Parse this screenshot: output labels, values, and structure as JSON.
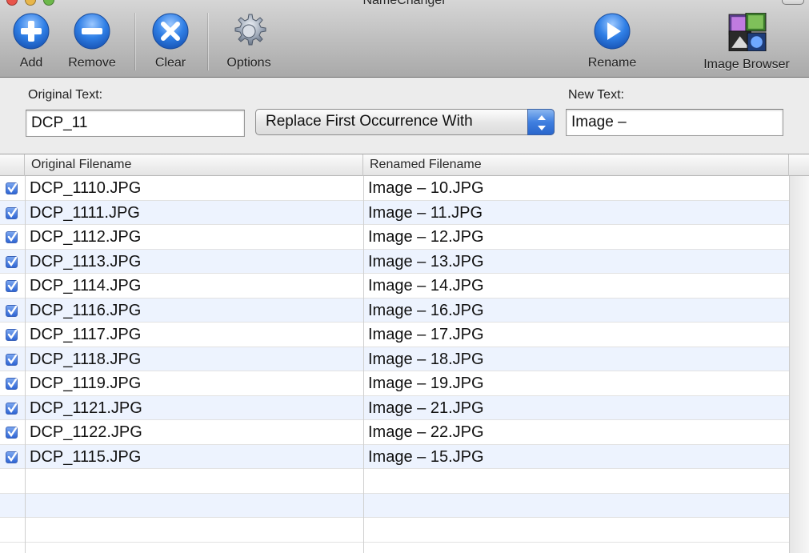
{
  "window": {
    "title": "NameChanger"
  },
  "toolbar": {
    "items": [
      {
        "label": "Add",
        "icon": "plus-circle-icon"
      },
      {
        "label": "Remove",
        "icon": "minus-circle-icon"
      },
      {
        "label": "Clear",
        "icon": "x-circle-icon"
      },
      {
        "label": "Options",
        "icon": "gear-icon"
      },
      {
        "label": "Rename",
        "icon": "play-circle-icon"
      },
      {
        "label": "Image Browser",
        "icon": "image-browser-icon"
      }
    ]
  },
  "controls": {
    "original_label": "Original Text:",
    "original_value": "DCP_11",
    "mode_value": "Replace First Occurrence With",
    "new_label": "New Text:",
    "new_value": "Image –"
  },
  "table": {
    "columns": [
      "Original Filename",
      "Renamed Filename"
    ],
    "rows": [
      {
        "checked": true,
        "original": "DCP_1110.JPG",
        "renamed": "Image – 10.JPG"
      },
      {
        "checked": true,
        "original": "DCP_1111.JPG",
        "renamed": "Image – 11.JPG"
      },
      {
        "checked": true,
        "original": "DCP_1112.JPG",
        "renamed": "Image – 12.JPG"
      },
      {
        "checked": true,
        "original": "DCP_1113.JPG",
        "renamed": "Image – 13.JPG"
      },
      {
        "checked": true,
        "original": "DCP_1114.JPG",
        "renamed": "Image – 14.JPG"
      },
      {
        "checked": true,
        "original": "DCP_1116.JPG",
        "renamed": "Image – 16.JPG"
      },
      {
        "checked": true,
        "original": "DCP_1117.JPG",
        "renamed": "Image – 17.JPG"
      },
      {
        "checked": true,
        "original": "DCP_1118.JPG",
        "renamed": "Image – 18.JPG"
      },
      {
        "checked": true,
        "original": "DCP_1119.JPG",
        "renamed": "Image – 19.JPG"
      },
      {
        "checked": true,
        "original": "DCP_1121.JPG",
        "renamed": "Image – 21.JPG"
      },
      {
        "checked": true,
        "original": "DCP_1122.JPG",
        "renamed": "Image – 22.JPG"
      },
      {
        "checked": true,
        "original": "DCP_1115.JPG",
        "renamed": "Image – 15.JPG"
      }
    ]
  },
  "colors": {
    "accent": "#2f7fe6",
    "row_alt": "#edf3fe"
  }
}
